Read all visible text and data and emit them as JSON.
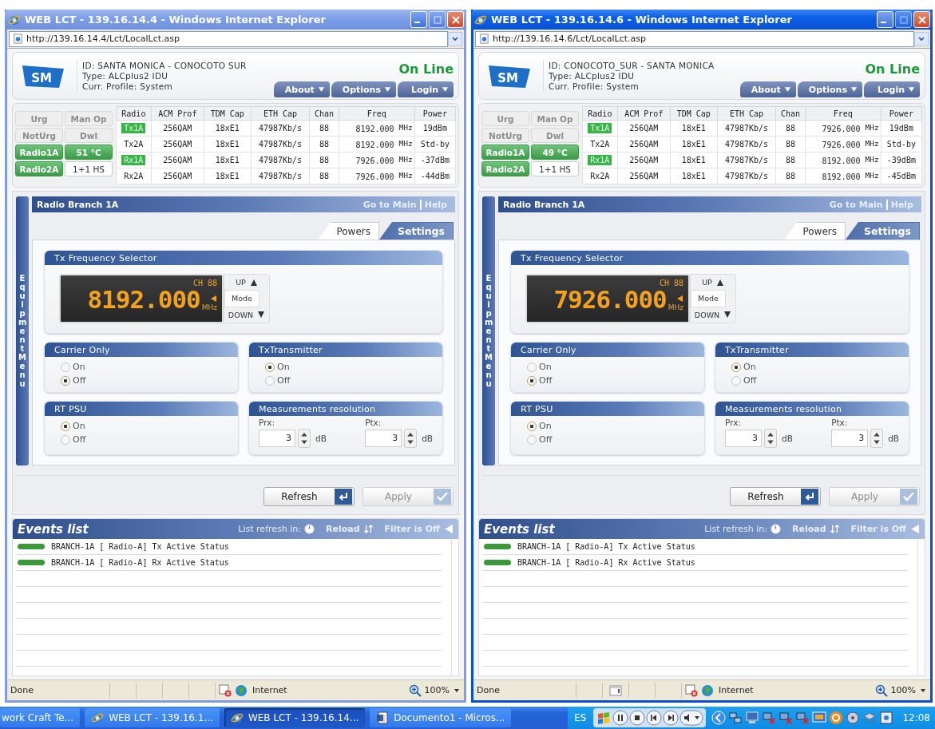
{
  "windows": [
    {
      "title": "WEB LCT - 139.16.14.4 - Windows Internet Explorer",
      "active": false,
      "address": "http://139.16.14.4/Lct/LocalLct.asp",
      "logo": "SM",
      "device_lines": [
        "ID: SANTA MONICA - CONOCOTO SUR",
        "Type: ALCplus2 IDU",
        "Curr. Profile: System"
      ],
      "connection": "On Line",
      "menus": [
        "About",
        "Options",
        "Login"
      ],
      "alarms": [
        {
          "label": "Urg",
          "kind": "led",
          "lit": false
        },
        {
          "label": "Man Op",
          "kind": "led",
          "lit": false
        },
        {
          "label": "NotUrg",
          "kind": "led",
          "lit": false
        },
        {
          "label": "Dwl",
          "kind": "led",
          "lit": false
        },
        {
          "label": "Radio1A",
          "kind": "led",
          "lit": true
        },
        {
          "label": "51 °C",
          "kind": "led",
          "lit": true
        },
        {
          "label": "Radio2A",
          "kind": "led",
          "lit": true
        },
        {
          "label": "1+1 HS",
          "kind": "readout",
          "lit": false
        }
      ],
      "radio_table": {
        "columns": [
          "Radio",
          "ACM Prof",
          "TDM Cap",
          "ETH Cap",
          "Chan",
          "Freq",
          "Power"
        ],
        "rows": [
          {
            "radio": "Tx1A",
            "active": true,
            "acm_prof": "256QAM",
            "tdm_cap": "18xE1",
            "eth_cap": "47987Kb/s",
            "chan": "88",
            "freq": "8192.000",
            "freq_unit": "MHz",
            "power": "19dBm"
          },
          {
            "radio": "Tx2A",
            "active": false,
            "acm_prof": "256QAM",
            "tdm_cap": "18xE1",
            "eth_cap": "47987Kb/s",
            "chan": "88",
            "freq": "8192.000",
            "freq_unit": "MHz",
            "power": "Std-by"
          },
          {
            "radio": "Rx1A",
            "active": true,
            "acm_prof": "256QAM",
            "tdm_cap": "18xE1",
            "eth_cap": "47987Kb/s",
            "chan": "88",
            "freq": "7926.000",
            "freq_unit": "MHz",
            "power": "-37dBm"
          },
          {
            "radio": "Rx2A",
            "active": false,
            "acm_prof": "256QAM",
            "tdm_cap": "18xE1",
            "eth_cap": "47987Kb/s",
            "chan": "88",
            "freq": "7926.000",
            "freq_unit": "MHz",
            "power": "-44dBm"
          }
        ]
      },
      "branch": {
        "title": "Radio Branch 1A",
        "links": [
          "Go to Main",
          "Help"
        ],
        "side_menu": "Equipment Menu",
        "tabs": [
          {
            "label": "Powers",
            "selected": false
          },
          {
            "label": "Settings",
            "selected": true
          }
        ],
        "freq_selector": {
          "title": "Tx Frequency Selector",
          "channel": "CH 88",
          "value": "8192.000",
          "unit": "MHz",
          "buttons": [
            "UP",
            "Mode",
            "DOWN"
          ]
        },
        "panels": [
          {
            "kind": "radio",
            "title": "Carrier Only",
            "options": [
              {
                "label": "On",
                "selected": false
              },
              {
                "label": "Off",
                "selected": true
              }
            ]
          },
          {
            "kind": "radio",
            "title": "TxTransmitter",
            "options": [
              {
                "label": "On",
                "selected": true
              },
              {
                "label": "Off",
                "selected": false
              }
            ]
          },
          {
            "kind": "radio",
            "title": "RT PSU",
            "options": [
              {
                "label": "On",
                "selected": true
              },
              {
                "label": "Off",
                "selected": false
              }
            ]
          },
          {
            "kind": "resolution",
            "title": "Measurements resolution",
            "fields": [
              {
                "label": "Prx:",
                "value": "3",
                "unit": "dB"
              },
              {
                "label": "Ptx:",
                "value": "3",
                "unit": "dB"
              }
            ]
          }
        ],
        "actions": [
          {
            "label": "Refresh",
            "disabled": false
          },
          {
            "label": "Apply",
            "disabled": true
          }
        ]
      },
      "events": {
        "title": "Events list",
        "refresh_label": "List refresh in:",
        "reload": "Reload",
        "filter": "Filter is Off",
        "items": [
          {
            "text": "BRANCH-1A [ Radio-A] Tx Active Status",
            "color": "#3a9a3a"
          },
          {
            "text": "BRANCH-1A [ Radio-A] Rx Active Status",
            "color": "#3a9a3a"
          }
        ]
      },
      "status_bar": {
        "text": "Done",
        "page_notice": false,
        "zone": "Internet",
        "zoom": "100%"
      }
    },
    {
      "title": "WEB LCT - 139.16.14.6 - Windows Internet Explorer",
      "active": true,
      "address": "http://139.16.14.6/Lct/LocalLct.asp",
      "logo": "SM",
      "device_lines": [
        "ID: CONOCOTO_SUR - SANTA MONICA",
        "Type: ALCplus2 IDU",
        "Curr. Profile: System"
      ],
      "connection": "On Line",
      "menus": [
        "About",
        "Options",
        "Login"
      ],
      "alarms": [
        {
          "label": "Urg",
          "kind": "led",
          "lit": false
        },
        {
          "label": "Man Op",
          "kind": "led",
          "lit": false
        },
        {
          "label": "NotUrg",
          "kind": "led",
          "lit": false
        },
        {
          "label": "Dwl",
          "kind": "led",
          "lit": false
        },
        {
          "label": "Radio1A",
          "kind": "led",
          "lit": true
        },
        {
          "label": "49 °C",
          "kind": "led",
          "lit": true
        },
        {
          "label": "Radio2A",
          "kind": "led",
          "lit": true
        },
        {
          "label": "1+1 HS",
          "kind": "readout",
          "lit": false
        }
      ],
      "radio_table": {
        "columns": [
          "Radio",
          "ACM Prof",
          "TDM Cap",
          "ETH Cap",
          "Chan",
          "Freq",
          "Power"
        ],
        "rows": [
          {
            "radio": "Tx1A",
            "active": true,
            "acm_prof": "256QAM",
            "tdm_cap": "18xE1",
            "eth_cap": "47987Kb/s",
            "chan": "88",
            "freq": "7926.000",
            "freq_unit": "MHz",
            "power": "19dBm"
          },
          {
            "radio": "Tx2A",
            "active": false,
            "acm_prof": "256QAM",
            "tdm_cap": "18xE1",
            "eth_cap": "47987Kb/s",
            "chan": "88",
            "freq": "7926.000",
            "freq_unit": "MHz",
            "power": "Std-by"
          },
          {
            "radio": "Rx1A",
            "active": true,
            "acm_prof": "256QAM",
            "tdm_cap": "18xE1",
            "eth_cap": "47987Kb/s",
            "chan": "88",
            "freq": "8192.000",
            "freq_unit": "MHz",
            "power": "-39dBm"
          },
          {
            "radio": "Rx2A",
            "active": false,
            "acm_prof": "256QAM",
            "tdm_cap": "18xE1",
            "eth_cap": "47987Kb/s",
            "chan": "88",
            "freq": "8192.000",
            "freq_unit": "MHz",
            "power": "-45dBm"
          }
        ]
      },
      "branch": {
        "title": "Radio Branch 1A",
        "links": [
          "Go to Main",
          "Help"
        ],
        "side_menu": "Equipment Menu",
        "tabs": [
          {
            "label": "Powers",
            "selected": false
          },
          {
            "label": "Settings",
            "selected": true
          }
        ],
        "freq_selector": {
          "title": "Tx Frequency Selector",
          "channel": "CH 88",
          "value": "7926.000",
          "unit": "MHz",
          "buttons": [
            "UP",
            "Mode",
            "DOWN"
          ]
        },
        "panels": [
          {
            "kind": "radio",
            "title": "Carrier Only",
            "options": [
              {
                "label": "On",
                "selected": false
              },
              {
                "label": "Off",
                "selected": true
              }
            ]
          },
          {
            "kind": "radio",
            "title": "TxTransmitter",
            "options": [
              {
                "label": "On",
                "selected": true
              },
              {
                "label": "Off",
                "selected": false
              }
            ]
          },
          {
            "kind": "radio",
            "title": "RT PSU",
            "options": [
              {
                "label": "On",
                "selected": true
              },
              {
                "label": "Off",
                "selected": false
              }
            ]
          },
          {
            "kind": "resolution",
            "title": "Measurements resolution",
            "fields": [
              {
                "label": "Prx:",
                "value": "3",
                "unit": "dB"
              },
              {
                "label": "Ptx:",
                "value": "3",
                "unit": "dB"
              }
            ]
          }
        ],
        "actions": [
          {
            "label": "Refresh",
            "disabled": false
          },
          {
            "label": "Apply",
            "disabled": true
          }
        ]
      },
      "events": {
        "title": "Events list",
        "refresh_label": "List refresh in:",
        "reload": "Reload",
        "filter": "Filter is Off",
        "items": [
          {
            "text": "BRANCH-1A [ Radio-A] Tx Active Status",
            "color": "#3a9a3a"
          },
          {
            "text": "BRANCH-1A [ Radio-A] Rx Active Status",
            "color": "#3a9a3a"
          }
        ]
      },
      "status_bar": {
        "text": "Done",
        "page_notice": true,
        "zone": "Internet",
        "zoom": "100%"
      }
    }
  ],
  "taskbar": {
    "items": [
      {
        "label": "work Craft Te...",
        "kind": "plain",
        "selected": false
      },
      {
        "label": "WEB LCT - 139.16.1...",
        "kind": "browser",
        "selected": false
      },
      {
        "label": "WEB LCT - 139.16.14...",
        "kind": "browser",
        "selected": true
      },
      {
        "label": "Documento1 - Micros...",
        "kind": "document",
        "selected": false
      }
    ],
    "language": "ES",
    "clock": "12:08"
  }
}
